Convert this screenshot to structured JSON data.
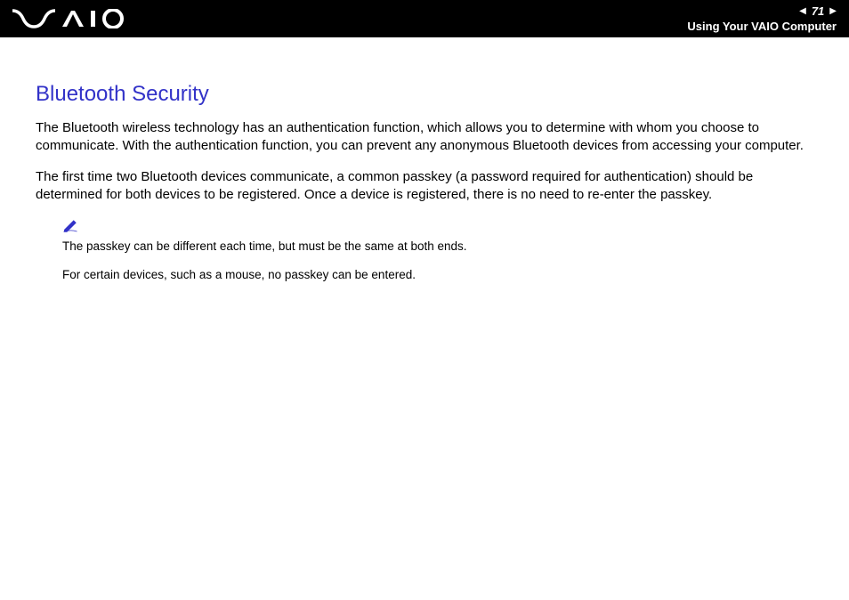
{
  "header": {
    "page_number": "71",
    "title": "Using Your VAIO Computer"
  },
  "section": {
    "title": "Bluetooth Security",
    "paragraph1": "The Bluetooth wireless technology has an authentication function, which allows you to determine with whom you choose to communicate. With the authentication function, you can prevent any anonymous Bluetooth devices from accessing your computer.",
    "paragraph2": "The first time two Bluetooth devices communicate, a common passkey (a password required for authentication) should be determined for both devices to be registered. Once a device is registered, there is no need to re-enter the passkey."
  },
  "notes": {
    "note1": "The passkey can be different each time, but must be the same at both ends.",
    "note2": "For certain devices, such as a mouse, no passkey can be entered."
  }
}
